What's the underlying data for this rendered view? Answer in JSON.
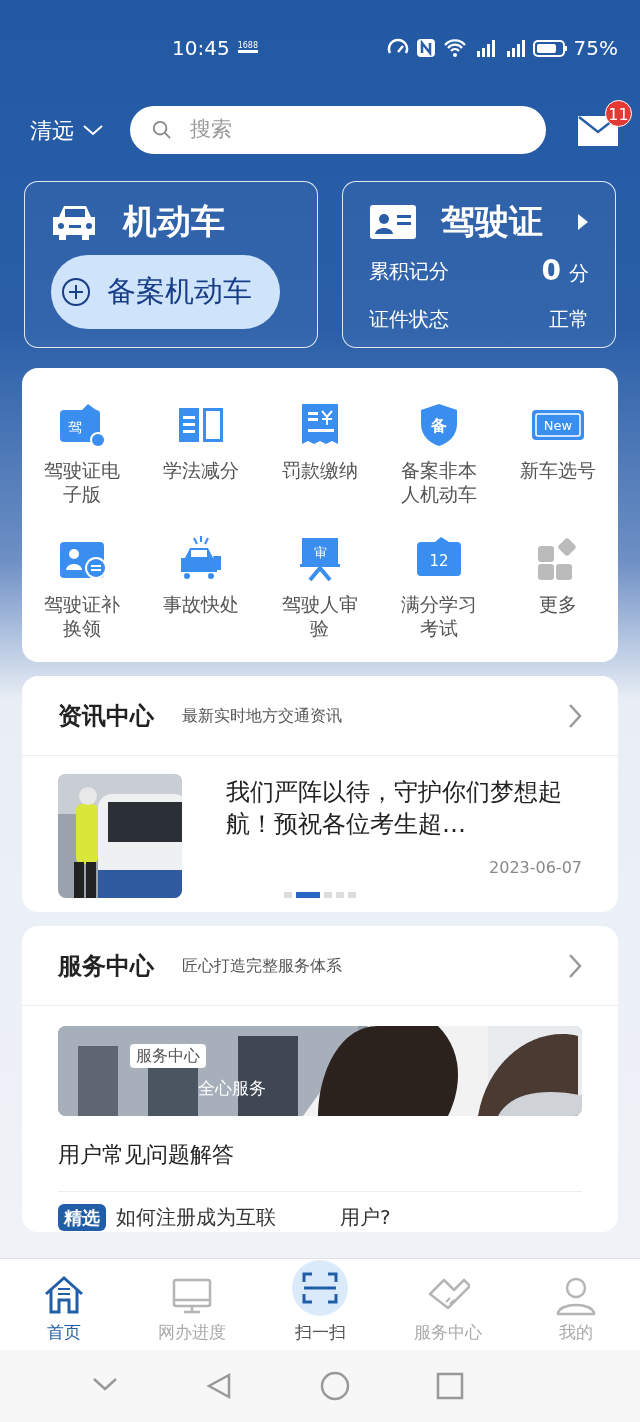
{
  "status_bar": {
    "time": "10:45",
    "badge": "1688",
    "battery": "75%"
  },
  "header": {
    "city": "清远",
    "search": {
      "placeholder": "搜索"
    },
    "mail_badge": "11"
  },
  "vehicle_card": {
    "title": "机动车",
    "button": "备案机动车"
  },
  "license_card": {
    "title": "驾驶证",
    "rows": [
      {
        "label": "累积记分",
        "value": "0",
        "unit": "分"
      },
      {
        "label": "证件状态",
        "value": "正常"
      }
    ]
  },
  "services": [
    {
      "label": "驾驶证电子版",
      "icon_text": "驾"
    },
    {
      "label": "学法减分"
    },
    {
      "label": "罚款缴纳"
    },
    {
      "label": "备案非本人机动车",
      "icon_text": "备"
    },
    {
      "label": "新车选号",
      "icon_text": "New"
    },
    {
      "label": "驾驶证补换领"
    },
    {
      "label": "事故快处"
    },
    {
      "label": "驾驶人审验",
      "icon_text": "审"
    },
    {
      "label": "满分学习考试",
      "icon_text": "12"
    },
    {
      "label": "更多"
    }
  ],
  "news": {
    "title": "资讯中心",
    "subtitle": "最新实时地方交通资讯",
    "headline": "我们严阵以待，守护你们梦想起航！预祝各位考生超…",
    "date": "2023-06-07",
    "pager": [
      {
        "selected": false
      },
      {
        "selected": true
      },
      {
        "selected": false
      },
      {
        "selected": false
      },
      {
        "selected": false
      }
    ]
  },
  "service_center": {
    "title": "服务中心",
    "subtitle": "匠心打造完整服务体系",
    "banner": {
      "tag": "服务中心",
      "caption": "全心服务"
    },
    "faq_title": "用户常见问题解答",
    "faq_item": {
      "tag": "精选",
      "text_before": "如何注册成为互联",
      "text_after": "用户?"
    }
  },
  "bottom_nav": [
    {
      "label": "首页",
      "selected": true,
      "kind": "tab"
    },
    {
      "label": "网办进度",
      "selected": false,
      "kind": "tab"
    },
    {
      "label": "扫一扫",
      "selected": false,
      "kind": "scan"
    },
    {
      "label": "服务中心",
      "selected": false,
      "kind": "tab"
    },
    {
      "label": "我的",
      "selected": false,
      "kind": "tab"
    }
  ]
}
